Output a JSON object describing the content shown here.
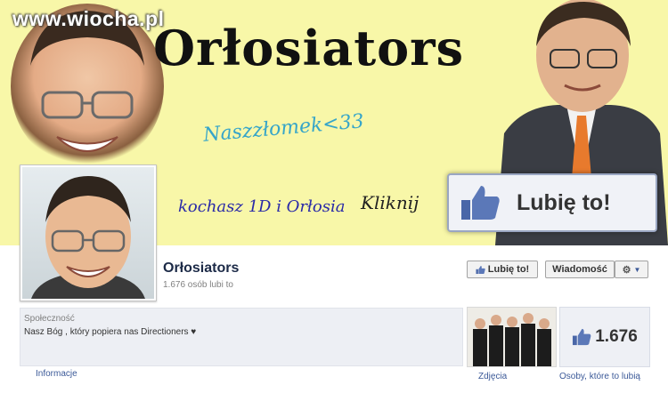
{
  "cover": {
    "watermark": "www.wiocha.pl",
    "title_art": "Orłosiators",
    "subtitle_art": "Naszzłomek<33",
    "line_art": "kochasz 1D i Orłosia",
    "click_art": "Kliknij",
    "big_like_label": "Lubię to!"
  },
  "page": {
    "name": "Orłosiators",
    "likes_text": "1.676 osób lubi to",
    "like_button": "Lubię to!",
    "message_button": "Wiadomość"
  },
  "about": {
    "category": "Społeczność",
    "description": "Nasz Bóg , który popiera nas Directioners ♥",
    "info_link": "Informacje"
  },
  "tiles": {
    "photos_label": "Zdjęcia",
    "likes_count": "1.676",
    "likes_label": "Osoby, które to lubią"
  },
  "colors": {
    "fb_blue": "#3b5998",
    "cover_yellow": "#f8f7a8"
  },
  "icons": [
    "thumbs-up-icon",
    "gear-icon",
    "chevron-down-icon"
  ]
}
